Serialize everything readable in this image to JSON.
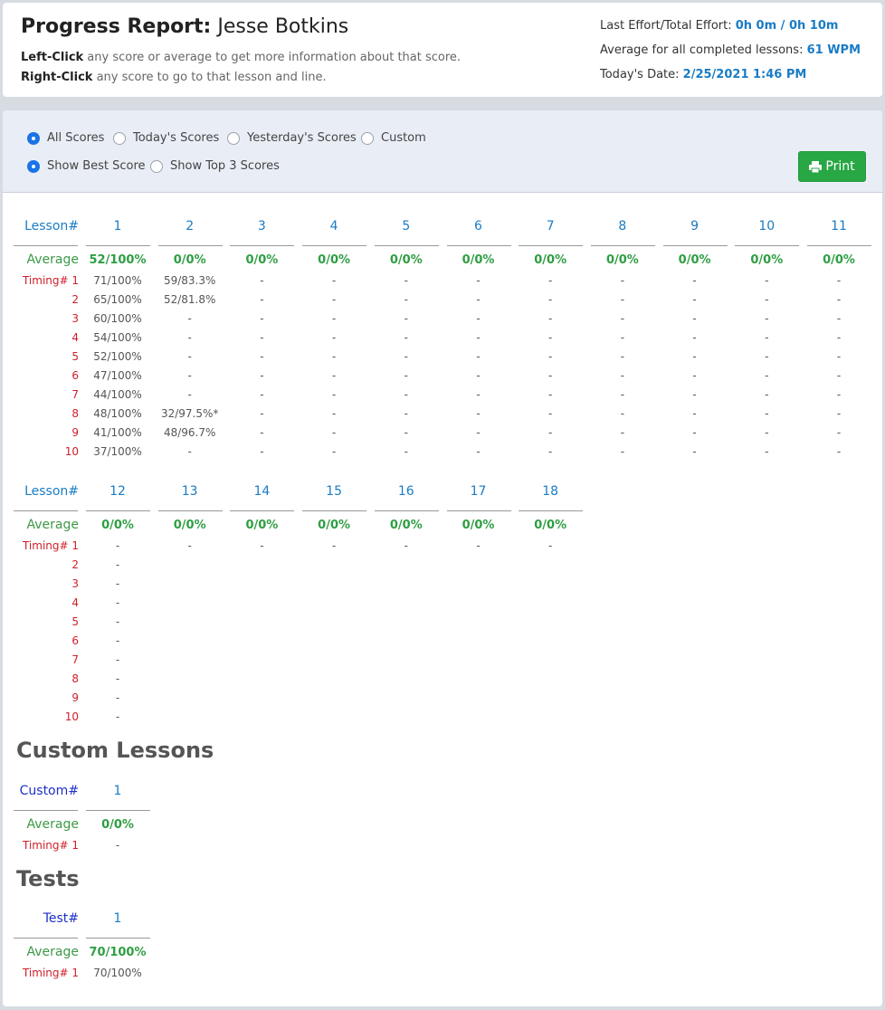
{
  "header": {
    "title_prefix": "Progress Report:",
    "student_name": "Jesse Botkins",
    "left_click_label": "Left-Click",
    "left_click_text": " any score or average to get more information about that score.",
    "right_click_label": "Right-Click",
    "right_click_text": " any score to go to that lesson and line.",
    "effort_label": "Last Effort/Total Effort: ",
    "effort_value": "0h 0m / 0h 10m",
    "avg_label": "Average for all completed lessons: ",
    "avg_value": "61 WPM",
    "date_label": "Today's Date: ",
    "date_value": "2/25/2021 1:46 PM"
  },
  "filters": {
    "range": [
      "All Scores",
      "Today's Scores",
      "Yesterday's Scores",
      "Custom"
    ],
    "range_selected": 0,
    "mode": [
      "Show Best Score",
      "Show Top 3 Scores"
    ],
    "mode_selected": 0,
    "print_label": "Print"
  },
  "labels": {
    "lesson": "Lesson#",
    "custom": "Custom#",
    "test": "Test#",
    "average": "Average",
    "timing": "Timing# 1"
  },
  "lessons_block1": {
    "numbers": [
      "1",
      "2",
      "3",
      "4",
      "5",
      "6",
      "7",
      "8",
      "9",
      "10",
      "11"
    ],
    "averages": [
      "52/100%",
      "0/0%",
      "0/0%",
      "0/0%",
      "0/0%",
      "0/0%",
      "0/0%",
      "0/0%",
      "0/0%",
      "0/0%",
      "0/0%"
    ],
    "timings": [
      [
        "71/100%",
        "59/83.3%",
        "-",
        "-",
        "-",
        "-",
        "-",
        "-",
        "-",
        "-",
        "-"
      ],
      [
        "65/100%",
        "52/81.8%",
        "-",
        "-",
        "-",
        "-",
        "-",
        "-",
        "-",
        "-",
        "-"
      ],
      [
        "60/100%",
        "-",
        "-",
        "-",
        "-",
        "-",
        "-",
        "-",
        "-",
        "-",
        "-"
      ],
      [
        "54/100%",
        "-",
        "-",
        "-",
        "-",
        "-",
        "-",
        "-",
        "-",
        "-",
        "-"
      ],
      [
        "52/100%",
        "-",
        "-",
        "-",
        "-",
        "-",
        "-",
        "-",
        "-",
        "-",
        "-"
      ],
      [
        "47/100%",
        "-",
        "-",
        "-",
        "-",
        "-",
        "-",
        "-",
        "-",
        "-",
        "-"
      ],
      [
        "44/100%",
        "-",
        "-",
        "-",
        "-",
        "-",
        "-",
        "-",
        "-",
        "-",
        "-"
      ],
      [
        "48/100%",
        "32/97.5%*",
        "-",
        "-",
        "-",
        "-",
        "-",
        "-",
        "-",
        "-",
        "-"
      ],
      [
        "41/100%",
        "48/96.7%",
        "-",
        "-",
        "-",
        "-",
        "-",
        "-",
        "-",
        "-",
        "-"
      ],
      [
        "37/100%",
        "-",
        "-",
        "-",
        "-",
        "-",
        "-",
        "-",
        "-",
        "-",
        "-"
      ]
    ]
  },
  "lessons_block2": {
    "numbers": [
      "12",
      "13",
      "14",
      "15",
      "16",
      "17",
      "18"
    ],
    "averages": [
      "0/0%",
      "0/0%",
      "0/0%",
      "0/0%",
      "0/0%",
      "0/0%",
      "0/0%"
    ],
    "timings": [
      [
        "-",
        "-",
        "-",
        "-",
        "-",
        "-",
        "-"
      ],
      [
        "-"
      ],
      [
        "-"
      ],
      [
        "-"
      ],
      [
        "-"
      ],
      [
        "-"
      ],
      [
        "-"
      ],
      [
        "-"
      ],
      [
        "-"
      ],
      [
        "-"
      ]
    ]
  },
  "row_numbers": [
    "2",
    "3",
    "4",
    "5",
    "6",
    "7",
    "8",
    "9",
    "10"
  ],
  "custom_section": {
    "title": "Custom Lessons",
    "numbers": [
      "1"
    ],
    "averages": [
      "0/0%"
    ],
    "timings": [
      [
        "-"
      ]
    ]
  },
  "tests_section": {
    "title": "Tests",
    "numbers": [
      "1"
    ],
    "averages": [
      "70/100%"
    ],
    "timings": [
      [
        "70/100%"
      ]
    ]
  },
  "colors": {
    "accent_blue": "#1a7cc4",
    "green": "#2e9e43",
    "red": "#d0202a",
    "print_green": "#28a745"
  }
}
